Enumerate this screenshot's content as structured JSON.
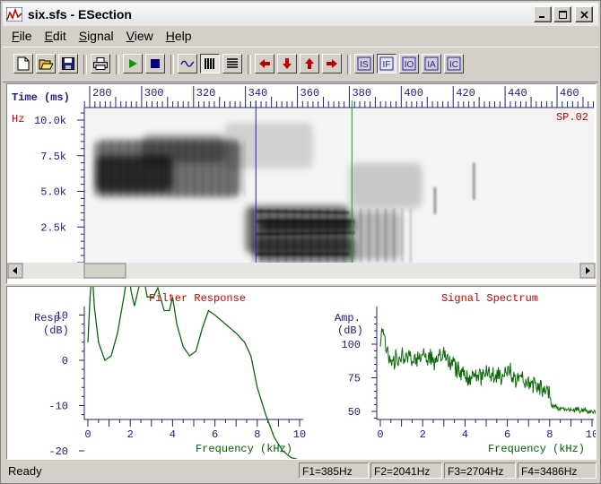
{
  "window": {
    "title": "six.sfs - ESection"
  },
  "menu": [
    "File",
    "Edit",
    "Signal",
    "View",
    "Help"
  ],
  "toolbar": {
    "icons": [
      "new-icon",
      "open-icon",
      "save-icon",
      "print-icon",
      "play-icon",
      "stop-icon",
      "waveform-icon",
      "wideband-spectrogram-icon",
      "narrowband-spectrogram-icon",
      "arrow-left-icon",
      "arrow-down-icon",
      "arrow-up-icon",
      "arrow-right-icon",
      "IS",
      "IF",
      "IO",
      "IA",
      "IC"
    ]
  },
  "spectrogram": {
    "time_label": "Time (ms)",
    "time_ticks": [
      "280",
      "300",
      "320",
      "340",
      "360",
      "380",
      "400",
      "420",
      "440",
      "460"
    ],
    "freq_unit": "Hz",
    "freq_ticks": [
      "10.0k",
      "7.5k",
      "5.0k",
      "2.5k"
    ],
    "item_label": "SP.02",
    "cursor_blue_ms": 344,
    "cursor_green_ms": 381
  },
  "filter_response": {
    "title": "Filter Response",
    "ylabel1": "Resp.",
    "ylabel2": "(dB)",
    "xlabel": "Frequency (kHz)",
    "y_ticks": [
      "10",
      "0",
      "-10",
      "-20"
    ],
    "x_ticks": [
      "0",
      "2",
      "4",
      "6",
      "8",
      "10"
    ]
  },
  "signal_spectrum": {
    "title": "Signal Spectrum",
    "ylabel1": "Amp.",
    "ylabel2": "(dB)",
    "xlabel": "Frequency (kHz)",
    "y_ticks": [
      "100",
      "75",
      "50"
    ],
    "x_ticks": [
      "0",
      "2",
      "4",
      "6",
      "8",
      "10"
    ]
  },
  "status": {
    "ready": "Ready",
    "f1": "F1=385Hz",
    "f2": "F2=2041Hz",
    "f3": "F3=2704Hz",
    "f4": "F4=3486Hz"
  },
  "colors": {
    "accent_red": "#cc0000",
    "axis_blue": "#202080",
    "plot_green": "#0a6a0a",
    "cursor_blue": "#2020c0",
    "cursor_green": "#20a020"
  }
}
